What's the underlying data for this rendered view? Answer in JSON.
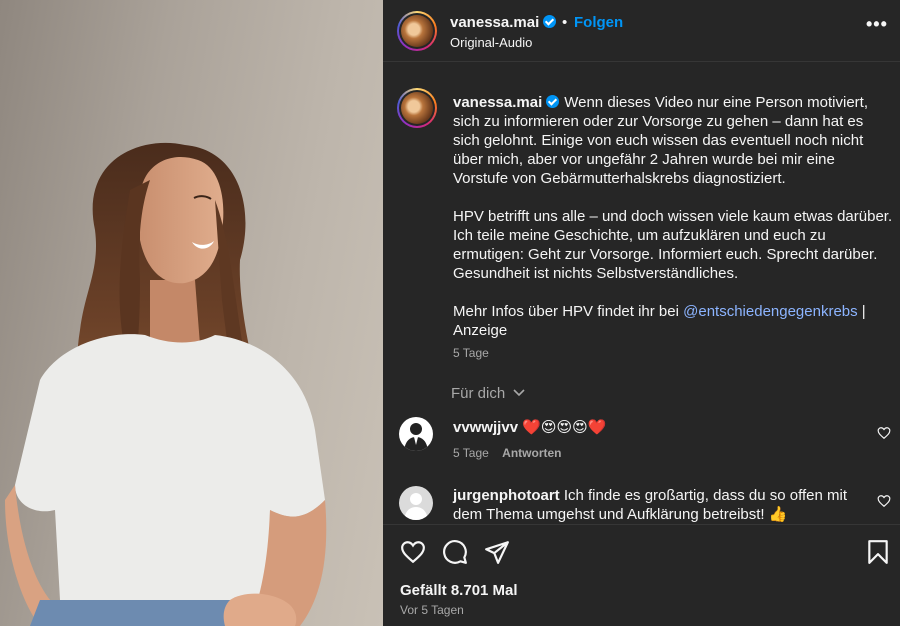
{
  "header": {
    "username": "vanessa.mai",
    "separator": "•",
    "follow_label": "Folgen",
    "audio": "Original-Audio",
    "more_label": "•••"
  },
  "caption": {
    "username": "vanessa.mai",
    "para1": "Wenn dieses Video nur eine Person motiviert, sich zu informieren oder zur Vorsorge zu gehen – dann hat es sich gelohnt. Einige von euch wissen das eventuell noch nicht über mich, aber vor ungefähr 2 Jahren wurde bei mir eine Vorstufe von Gebärmutterhalskrebs diagnostiziert.",
    "para2": "HPV betrifft uns alle – und doch wissen viele kaum etwas darüber. Ich teile meine Geschichte, um aufzuklären und euch zu ermutigen: Geht zur Vorsorge. Informiert euch. Sprecht darüber. Gesundheit ist nichts Selbstverständliches.",
    "para3_prefix": "Mehr Infos über HPV findet ihr bei ",
    "mention": "@entschiedengegenkrebs",
    "para3_suffix": " | Anzeige",
    "age": "5 Tage"
  },
  "filter": {
    "label": "Für dich"
  },
  "comments": [
    {
      "username": "vvwwjjvv",
      "text": "❤️😍😍😍❤️",
      "age": "5 Tage",
      "reply_label": "Antworten"
    },
    {
      "username": "jurgenphotoart",
      "text": "Ich finde es großartig, dass du so offen mit dem Thema umgehst und Aufklärung betreibst! 👍"
    }
  ],
  "footer": {
    "likes": "Gefällt 8.701 Mal",
    "posted": "Vor 5 Tagen"
  },
  "colors": {
    "accent": "#0095f6",
    "panel_bg": "#262626",
    "mention": "#8cb4ff"
  }
}
